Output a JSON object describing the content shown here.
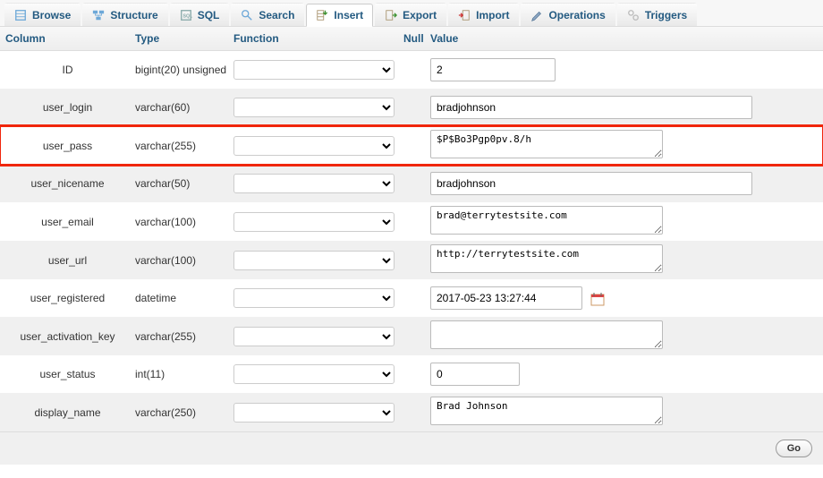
{
  "tabs": {
    "browse": "Browse",
    "structure": "Structure",
    "sql": "SQL",
    "search": "Search",
    "insert": "Insert",
    "export": "Export",
    "import": "Import",
    "operations": "Operations",
    "triggers": "Triggers"
  },
  "headers": {
    "column": "Column",
    "type": "Type",
    "function": "Function",
    "null": "Null",
    "value": "Value"
  },
  "rows": {
    "id": {
      "column": "ID",
      "type": "bigint(20) unsigned",
      "value": "2"
    },
    "user_login": {
      "column": "user_login",
      "type": "varchar(60)",
      "value": "bradjohnson"
    },
    "user_pass": {
      "column": "user_pass",
      "type": "varchar(255)",
      "value": "$P$Bo3Pgp0pv.8/h"
    },
    "user_nicename": {
      "column": "user_nicename",
      "type": "varchar(50)",
      "value": "bradjohnson"
    },
    "user_email": {
      "column": "user_email",
      "type": "varchar(100)",
      "value": "brad@terrytestsite.com"
    },
    "user_url": {
      "column": "user_url",
      "type": "varchar(100)",
      "value": "http://terrytestsite.com"
    },
    "user_registered": {
      "column": "user_registered",
      "type": "datetime",
      "value": "2017-05-23 13:27:44"
    },
    "user_activation_key": {
      "column": "user_activation_key",
      "type": "varchar(255)",
      "value": ""
    },
    "user_status": {
      "column": "user_status",
      "type": "int(11)",
      "value": "0"
    },
    "display_name": {
      "column": "display_name",
      "type": "varchar(250)",
      "value": "Brad Johnson"
    }
  },
  "footer": {
    "go": "Go"
  }
}
